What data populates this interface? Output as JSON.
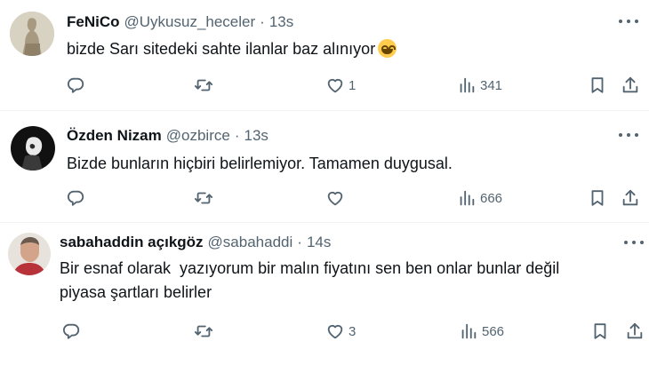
{
  "tweets": [
    {
      "name": "FeNiCo",
      "handle": "@Uykusuz_heceler",
      "dot": "·",
      "time": "13s",
      "text": "bizde Sarı sitedeki sahte ilanlar baz alınıyor",
      "emoji": "grinning-squinting-face",
      "likes": "1",
      "views": "341",
      "retweets": "",
      "replies": ""
    },
    {
      "name": "Özden Nizam",
      "handle": "@ozbirce",
      "dot": "·",
      "time": "13s",
      "text": "Bizde bunların hiçbiri belirlemiyor. Tamamen duygusal.",
      "likes": "",
      "views": "666",
      "retweets": "",
      "replies": ""
    },
    {
      "name": "sabahaddin açıkgöz",
      "handle": "@sabahaddi",
      "dot": "·",
      "time": "14s",
      "text_line1": "Bir esnaf olarak  yazıyorum bir malın fiyatını sen ben onlar bunlar değil",
      "text_line2": "piyasa şartları belirler",
      "likes": "3",
      "views": "566",
      "retweets": "",
      "replies": ""
    }
  ],
  "icons": {
    "reply": "reply-icon",
    "retweet": "retweet-icon",
    "like": "heart-icon",
    "views": "views-icon",
    "bookmark": "bookmark-icon",
    "share": "share-icon",
    "more": "more-icon"
  },
  "colors": {
    "text_primary": "#0f1419",
    "text_secondary": "#536471",
    "divider": "#eff3f4"
  }
}
